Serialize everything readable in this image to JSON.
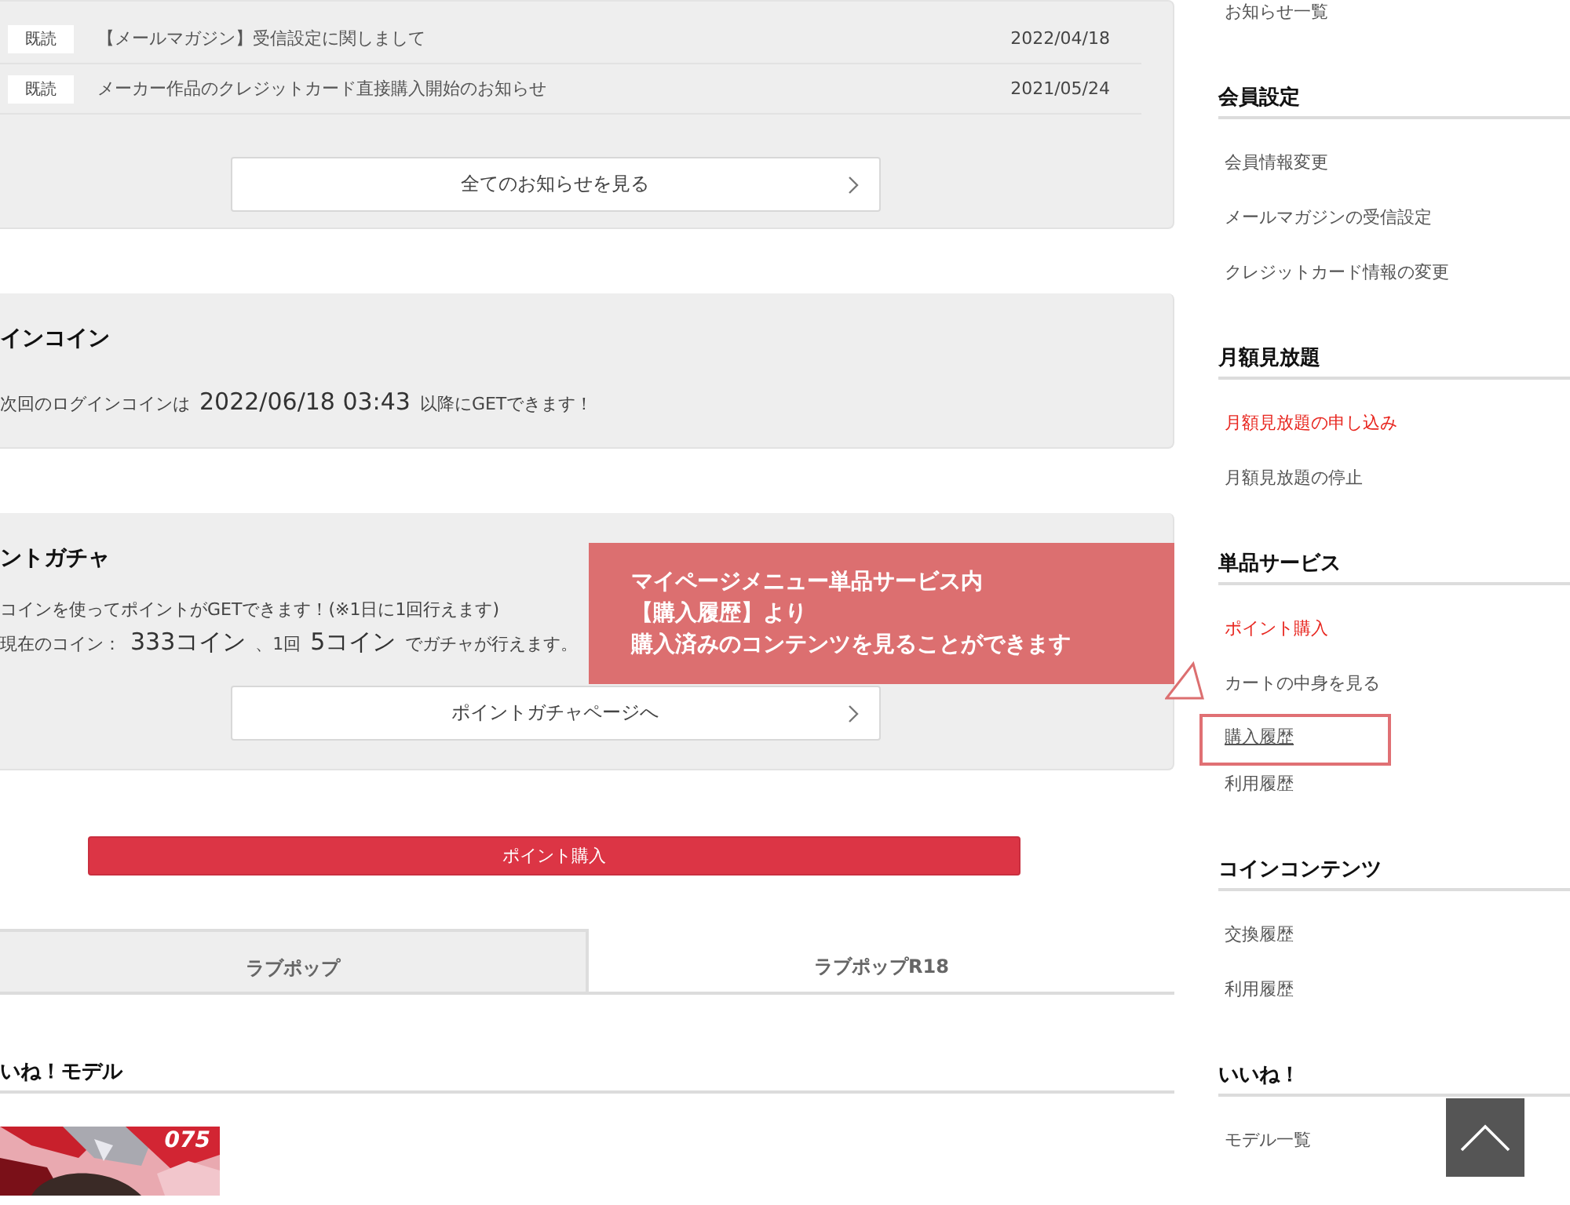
{
  "notices": [
    {
      "badge": "既読",
      "title": "【メールマガジン】受信設定に関しまして",
      "date": "2022/04/18"
    },
    {
      "badge": "既読",
      "title": "メーカー作品のクレジットカード直接購入開始のお知らせ",
      "date": "2021/05/24"
    }
  ],
  "all_notices_button": "全てのお知らせを見る",
  "login_coin": {
    "heading": "インコイン",
    "prefix": "次回のログインコインは",
    "datetime": "2022/06/18 03:43",
    "suffix": "以降にGETできます！"
  },
  "gacha": {
    "heading": "ントガチャ",
    "description": "コインを使ってポイントがGETできます！(※1日に1回行えます)",
    "coin_label": "現在のコイン：",
    "coins": "333コイン",
    "separator": "、1回",
    "cost": "5コイン",
    "suffix": "でガチャが行えます。",
    "button": "ポイントガチャページへ"
  },
  "purchase_button": "ポイント購入",
  "tabs": [
    {
      "label": "ラブポップ",
      "selected": false
    },
    {
      "label": "ラブポップR18",
      "selected": true
    }
  ],
  "liked_models": {
    "heading": "いね！モデル",
    "items": [
      {
        "kind": "picture",
        "badge": "075"
      }
    ]
  },
  "sidebar": {
    "top_link": "お知らせ一覧",
    "sections": [
      {
        "heading": "会員設定",
        "items": [
          {
            "label": "会員情報変更",
            "highlighted": false,
            "outlined": false
          },
          {
            "label": "メールマガジンの受信設定",
            "highlighted": false,
            "outlined": false
          },
          {
            "label": "クレジットカード情報の変更",
            "highlighted": false,
            "outlined": false
          }
        ]
      },
      {
        "heading": "月額見放題",
        "items": [
          {
            "label": "月額見放題の申し込み",
            "highlighted": true,
            "outlined": false
          },
          {
            "label": "月額見放題の停止",
            "highlighted": false,
            "outlined": false
          }
        ]
      },
      {
        "heading": "単品サービス",
        "items": [
          {
            "label": "ポイント購入",
            "highlighted": true,
            "outlined": false
          },
          {
            "label": "カートの中身を見る",
            "highlighted": false,
            "outlined": false
          },
          {
            "label": "購入履歴",
            "highlighted": false,
            "outlined": true
          },
          {
            "label": "利用履歴",
            "highlighted": false,
            "outlined": false
          }
        ]
      },
      {
        "heading": "コインコンテンツ",
        "items": [
          {
            "label": "交換履歴",
            "highlighted": false,
            "outlined": false
          },
          {
            "label": "利用履歴",
            "highlighted": false,
            "outlined": false
          }
        ]
      },
      {
        "heading": "いいね！",
        "items": [
          {
            "label": "モデル一覧",
            "highlighted": false,
            "outlined": false
          }
        ]
      }
    ]
  },
  "callout": {
    "lines": [
      "マイページメニュー単品サービス内",
      "【購入履歴】より",
      "購入済みのコンテンツを見ることができます"
    ]
  }
}
